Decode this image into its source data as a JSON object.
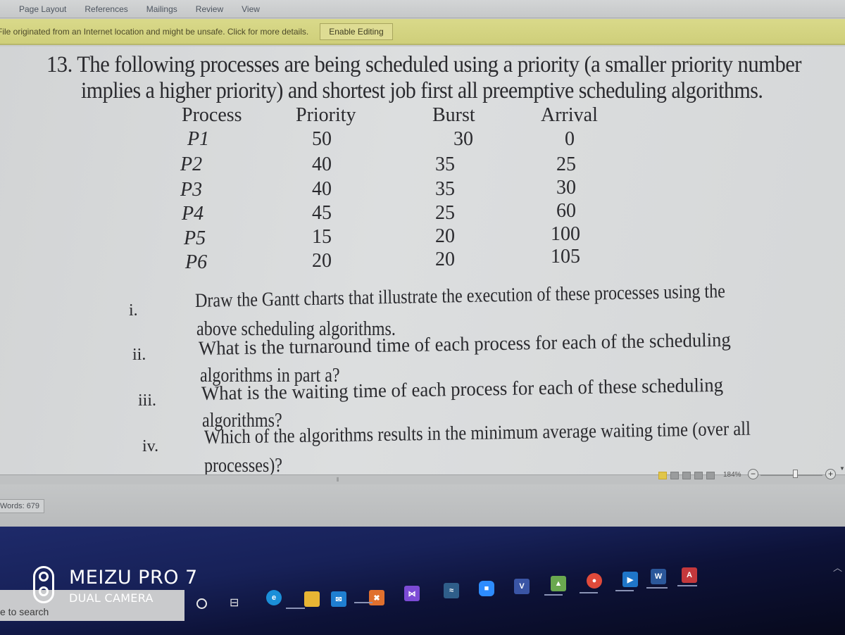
{
  "ribbon": {
    "tabs": [
      "Page Layout",
      "References",
      "Mailings",
      "Review",
      "View"
    ]
  },
  "protected_view": {
    "message": "File originated from an Internet location and might be unsafe. Click for more details.",
    "button_label": "Enable Editing"
  },
  "document": {
    "question_line1": "13. The following processes are being scheduled using a priority (a smaller priority number",
    "question_line2": "implies a higher priority) and shortest job first all preemptive scheduling algorithms.",
    "table": {
      "headers": [
        "Process",
        "Priority",
        "Burst",
        "Arrival"
      ],
      "rows": [
        [
          "P1",
          "50",
          "30",
          "0"
        ],
        [
          "P2",
          "40",
          "35",
          "25"
        ],
        [
          "P3",
          "40",
          "35",
          "30"
        ],
        [
          "P4",
          "45",
          "25",
          "60"
        ],
        [
          "P5",
          "15",
          "20",
          "100"
        ],
        [
          "P6",
          "20",
          "20",
          "105"
        ]
      ]
    },
    "parts": [
      {
        "num": "i.",
        "line1": "Draw the Gantt charts that illustrate the execution of these processes using the",
        "line2": "above scheduling algorithms."
      },
      {
        "num": "ii.",
        "line1": "What is the turnaround time of each process for each of the scheduling",
        "line2": "algorithms in part a?"
      },
      {
        "num": "iii.",
        "line1": "What is the waiting time of each process for each of these scheduling",
        "line2": "algorithms?"
      },
      {
        "num": "iv.",
        "line1": "Which of the algorithms results in the minimum average waiting time (over all",
        "line2": "processes)?"
      }
    ]
  },
  "statusbar": {
    "words": "Words: 679",
    "zoom_level": "184%",
    "zoom_minus": "−",
    "zoom_plus": "+"
  },
  "taskbar": {
    "search_placeholder": "Type here to search",
    "search_visible_text": "e to search",
    "apps": [
      {
        "name": "edge-icon",
        "glyph": "e",
        "color": "#1b8fd8"
      },
      {
        "name": "file-explorer-icon",
        "glyph": "",
        "color": "#e8b534"
      },
      {
        "name": "mail-icon",
        "glyph": "✉",
        "color": "#1f7fd1"
      },
      {
        "name": "xampp-icon",
        "glyph": "✖",
        "color": "#e0702e"
      },
      {
        "name": "visual-studio-icon",
        "glyph": "⋈",
        "color": "#7c4bd6"
      },
      {
        "name": "wireshark-icon",
        "glyph": "≈",
        "color": "#2f5e8a"
      },
      {
        "name": "zoom-icon",
        "glyph": "■",
        "color": "#2d8cff"
      },
      {
        "name": "visio-icon",
        "glyph": "V",
        "color": "#3a55a5"
      },
      {
        "name": "android-studio-icon",
        "glyph": "▲",
        "color": "#6aa84f"
      },
      {
        "name": "chrome-icon",
        "glyph": "●",
        "color": "#e04a3a"
      },
      {
        "name": "media-player-icon",
        "glyph": "▶",
        "color": "#1f76c9"
      },
      {
        "name": "word-icon",
        "glyph": "W",
        "color": "#2b579a"
      },
      {
        "name": "access-icon",
        "glyph": "A",
        "color": "#c4383c"
      }
    ]
  },
  "watermark": {
    "title": "MEIZU PRO 7",
    "subtitle": "DUAL CAMERA"
  }
}
